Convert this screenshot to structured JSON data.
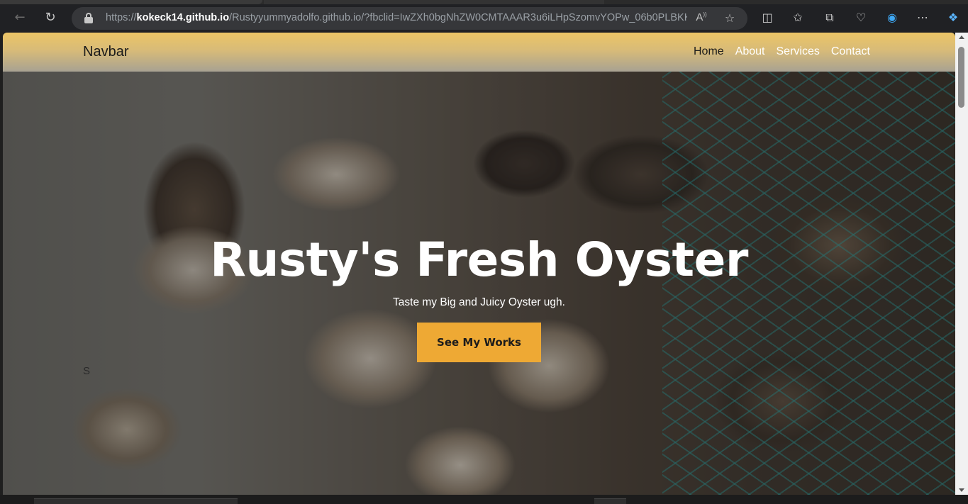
{
  "browser": {
    "url_prefix": "https://",
    "url_host": "kokeck14.github.io",
    "url_path": "/Rustyyummyadolfo.github.io/?fbclid=IwZXh0bgNhZW0CMTAAAR3u6iLHpSzomvYOPw_06b0PLBKKn7k5...",
    "icons": [
      "back-icon",
      "reload-icon",
      "lock-icon",
      "read-aloud-icon",
      "favorite-star-icon",
      "split-screen-icon",
      "favorites-icon",
      "collections-icon",
      "browser-essentials-icon",
      "edge-icon",
      "more-icon",
      "copilot-icon"
    ]
  },
  "navbar": {
    "brand": "Navbar",
    "links": [
      "Home",
      "About",
      "Services",
      "Contact"
    ]
  },
  "hero": {
    "title": "Rusty's Fresh Oyster",
    "subtitle": "Taste my Big and Juicy Oyster ugh.",
    "cta_label": "See My Works",
    "stray_text": "S"
  },
  "colors": {
    "navbar_top": "#ecc566",
    "cta_background": "#eea934",
    "hero_text": "#ffffff"
  }
}
